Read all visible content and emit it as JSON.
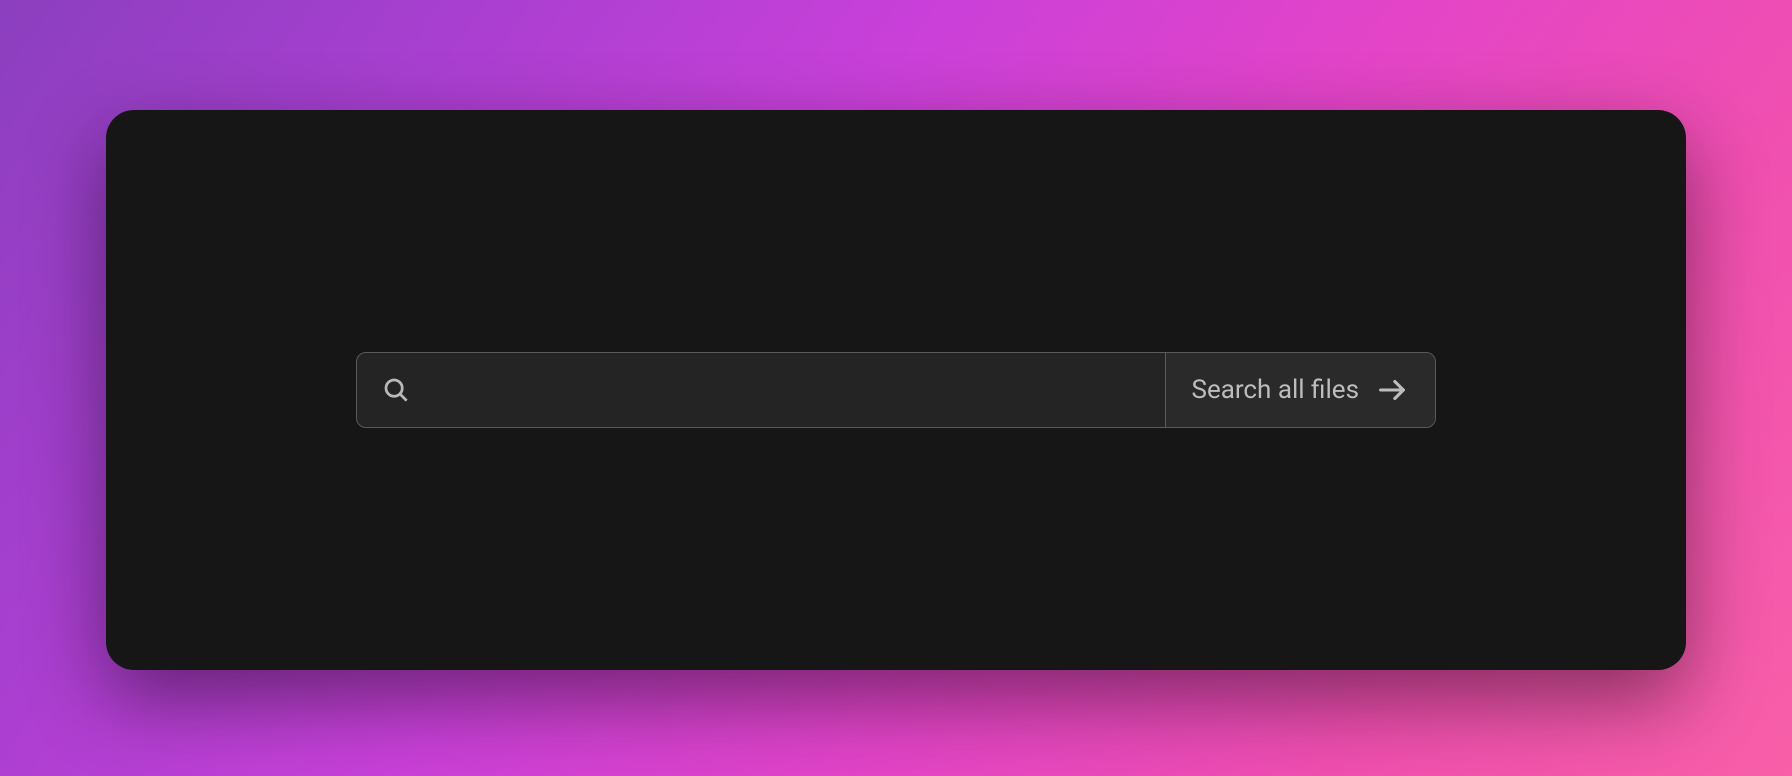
{
  "search": {
    "button_label": "Search all files",
    "input_value": ""
  }
}
